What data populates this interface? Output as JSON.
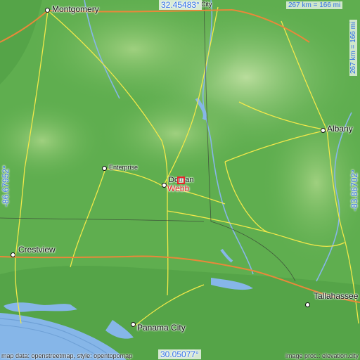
{
  "map": {
    "highlight": {
      "name": "Webb"
    },
    "cities": [
      {
        "name": "Montgomery",
        "key": "montgomery"
      },
      {
        "name": "Enterprise",
        "key": "enterprise"
      },
      {
        "name": "Dothan",
        "key": "dothan"
      },
      {
        "name": "Albany",
        "key": "albany"
      },
      {
        "name": "Crestview",
        "key": "crestview"
      },
      {
        "name": "Panama City",
        "key": "panama-city"
      },
      {
        "name": "Tallahassee",
        "key": "tallahassee"
      },
      {
        "name": "City",
        "key": "partial-city"
      }
    ],
    "coordinates": {
      "top": "32.45483°",
      "bottom": "30.05077°",
      "left": "-86.67952°",
      "right": "-83.86702°"
    },
    "scale": {
      "horizontal": "267 km = 166 mi",
      "vertical": "267 km = 166 mi"
    },
    "credits": {
      "left": "map data: openstreetmap, style: opentopomap",
      "right": "image proc.: elevation.city"
    },
    "colors": {
      "land": "#5fae4f",
      "highland": "#a7d48c",
      "water": "#86b6e8",
      "roads": "#f2e84a",
      "highways": "#e9883a",
      "highlight": "#e8232b",
      "coordinate_text": "#2f6ee8"
    }
  }
}
